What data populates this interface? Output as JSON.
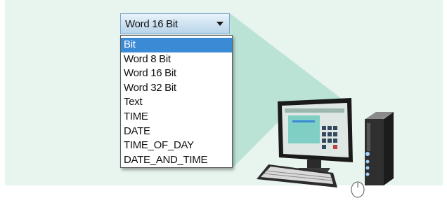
{
  "dropdown": {
    "selected_value": "Word 16 Bit"
  },
  "options": [
    {
      "label": "Bit",
      "selected": true
    },
    {
      "label": "Word 8 Bit",
      "selected": false
    },
    {
      "label": "Word 16 Bit",
      "selected": false
    },
    {
      "label": "Word 32 Bit",
      "selected": false
    },
    {
      "label": "Text",
      "selected": false
    },
    {
      "label": "TIME",
      "selected": false
    },
    {
      "label": "DATE",
      "selected": false
    },
    {
      "label": "TIME_OF_DAY",
      "selected": false
    },
    {
      "label": "DATE_AND_TIME",
      "selected": false
    }
  ],
  "icons": {
    "dropdown_arrow": "chevron-down-icon",
    "computer": "desktop-computer-icon"
  },
  "colors": {
    "panel_background": "#e8f4ee",
    "beam": "#b7e1d4",
    "selection": "#3a8ad6"
  }
}
